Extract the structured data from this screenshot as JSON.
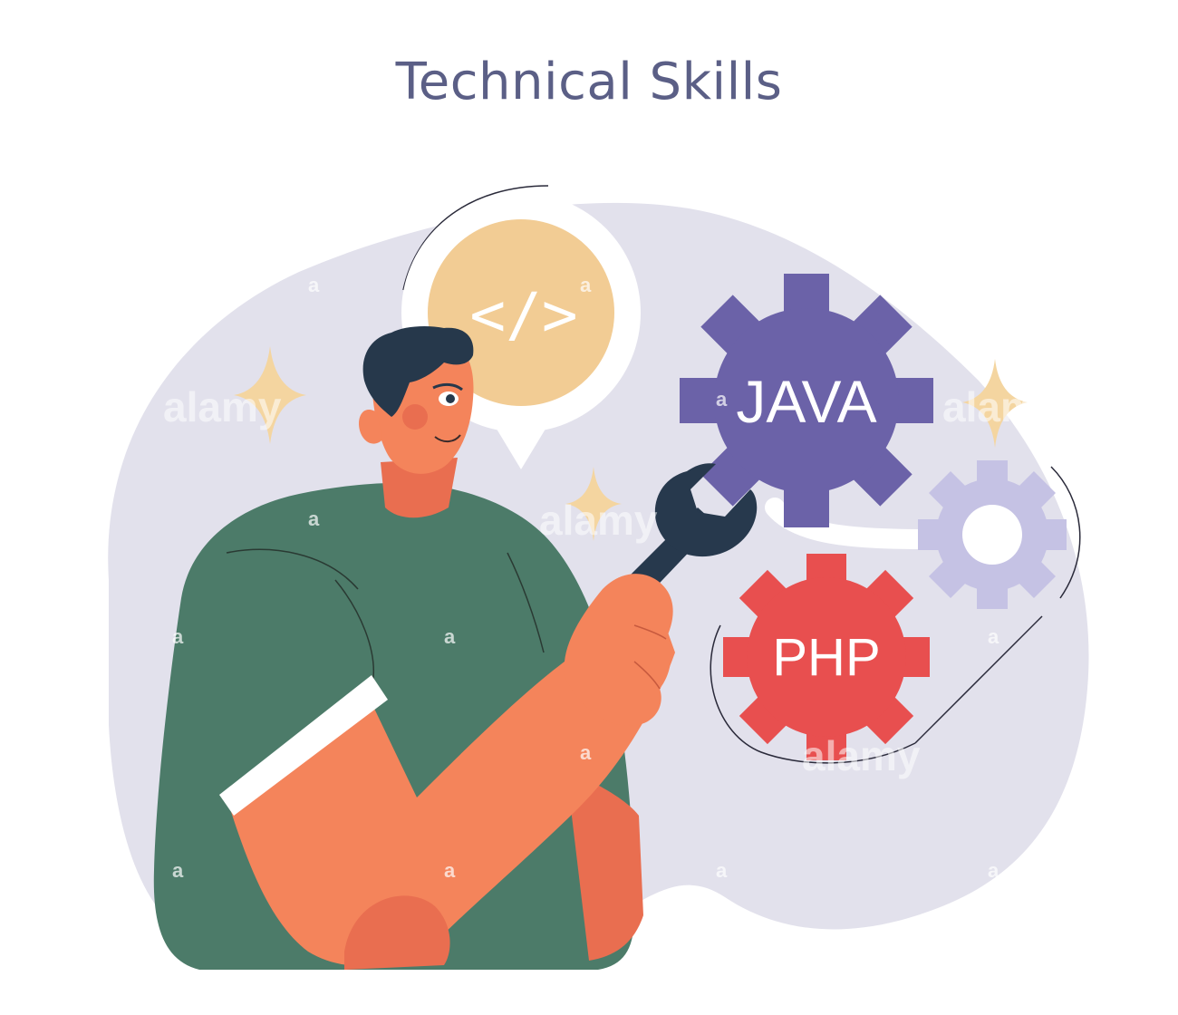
{
  "title": "Technical Skills",
  "bubble": {
    "icon": "code-icon",
    "code_text": "</>"
  },
  "gears": [
    {
      "label": "JAVA",
      "color": "#6b62a8"
    },
    {
      "label": "PHP",
      "color": "#e84f4f"
    },
    {
      "label": "",
      "color": "#c5c2e4"
    }
  ],
  "watermark": {
    "brand": "alamy",
    "letter": "a"
  },
  "colors": {
    "background_blob": "#e2e1ec",
    "shirt": "#4c7b69",
    "skin": "#f4845b",
    "hair": "#26384b",
    "wrench": "#27394d",
    "bubble": "#f2cc94",
    "sparkle": "#f4d5a0",
    "title": "#5b5f86"
  }
}
